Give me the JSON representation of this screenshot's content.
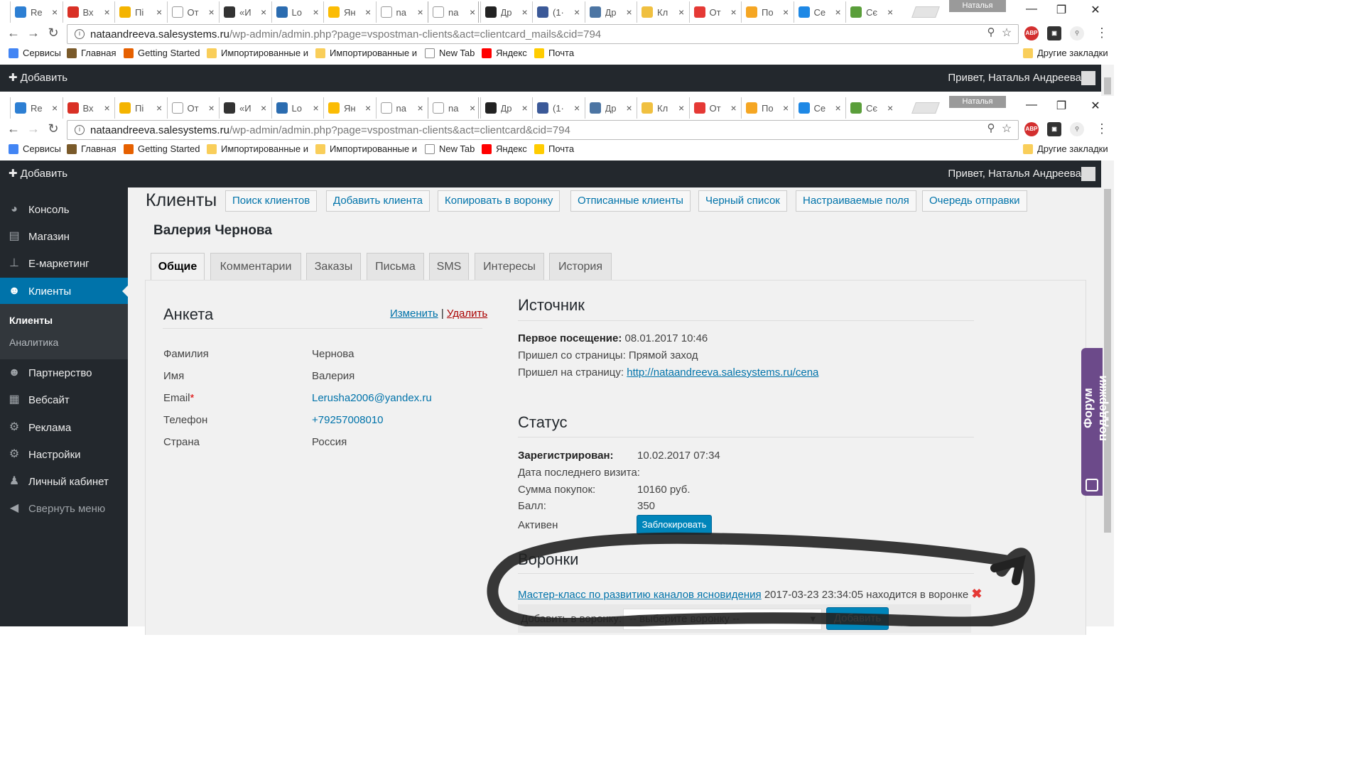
{
  "colors": {
    "accent": "#0073aa",
    "wp_bar": "#23282d",
    "support": "#6c4a8a"
  },
  "tabs": [
    {
      "label": "Re",
      "icon": "circle-at-icon",
      "color": "#2d7fd3"
    },
    {
      "label": "Вх",
      "icon": "gmail-icon",
      "color": "#d93025"
    },
    {
      "label": "Пі",
      "icon": "mail-icon",
      "color": "#f4b400"
    },
    {
      "label": "От",
      "icon": "page-icon",
      "color": "#ffffff"
    },
    {
      "label": "«И",
      "icon": "tv-icon",
      "color": "#333333"
    },
    {
      "label": "Lo",
      "icon": "p-icon",
      "color": "#2b6cb0"
    },
    {
      "label": "Ян",
      "icon": "drive-icon",
      "color": "#fbbc04"
    },
    {
      "label": "na",
      "icon": "page-icon",
      "color": "#ffffff"
    },
    {
      "label": "na",
      "icon": "page-icon",
      "color": "#ffffff"
    },
    {
      "label": "Др",
      "icon": "pro-icon",
      "color": "#222222"
    },
    {
      "label": "(1·",
      "icon": "facebook-icon",
      "color": "#3b5998"
    },
    {
      "label": "Др",
      "icon": "vk-icon",
      "color": "#4c75a3"
    },
    {
      "label": "Кл",
      "icon": "circle-icon",
      "color": "#f0c040"
    },
    {
      "label": "От",
      "icon": "arrow-icon",
      "color": "#e53935"
    },
    {
      "label": "По",
      "icon": "k-icon",
      "color": "#f5a623"
    },
    {
      "label": "Се",
      "icon": "hd-icon",
      "color": "#1e88e5"
    },
    {
      "label": "Сє",
      "icon": "puzzle-icon",
      "color": "#5a9e3a"
    }
  ],
  "profile_name": "Наталья",
  "window1": {
    "host": "nataandreeva.salesystems.ru",
    "path": "/wp-admin/admin.php?page=vspostman-clients&act=clientcard_mails&cid=794"
  },
  "window2": {
    "host": "nataandreeva.salesystems.ru",
    "path": "/wp-admin/admin.php?page=vspostman-clients&act=clientcard&cid=794"
  },
  "bookmarks": [
    {
      "label": "Сервисы",
      "color": "#4285f4"
    },
    {
      "label": "Главная",
      "color": "#7a5a2a"
    },
    {
      "label": "Getting Started",
      "color": "#e66000"
    },
    {
      "label": "Импортированные и",
      "color": "#f9ce5a"
    },
    {
      "label": "Импортированные и",
      "color": "#f9ce5a"
    },
    {
      "label": "New Tab",
      "color": "#ffffff"
    },
    {
      "label": "Яндекс",
      "color": "#ff0000"
    },
    {
      "label": "Почта",
      "color": "#ffcc00"
    }
  ],
  "other_bookmarks": "Другие закладки",
  "adminbar": {
    "add": "Добавить",
    "greeting": "Привет, Наталья Андреева"
  },
  "sidebar": {
    "items": [
      {
        "label": "Консоль",
        "icon": "dashboard-icon"
      },
      {
        "label": "Магазин",
        "icon": "store-icon"
      },
      {
        "label": "E-маркетинг",
        "icon": "sitemap-icon"
      },
      {
        "label": "Клиенты",
        "icon": "users-icon"
      },
      {
        "label": "Партнерство",
        "icon": "partners-icon"
      },
      {
        "label": "Вебсайт",
        "icon": "website-icon"
      },
      {
        "label": "Реклама",
        "icon": "gear-icon"
      },
      {
        "label": "Настройки",
        "icon": "settings-icon"
      },
      {
        "label": "Личный кабинет",
        "icon": "person-icon"
      },
      {
        "label": "Свернуть меню",
        "icon": "collapse-icon"
      }
    ],
    "sub": [
      "Клиенты",
      "Аналитика"
    ]
  },
  "page": {
    "title": "Клиенты",
    "buttons": [
      "Поиск клиентов",
      "Добавить клиента",
      "Копировать в воронку",
      "Отписанные клиенты",
      "Черный список",
      "Настраиваемые поля",
      "Очередь отправки"
    ],
    "client_name": "Валерия Чернова",
    "tabs": [
      "Общие",
      "Комментарии",
      "Заказы",
      "Письма",
      "SMS",
      "Интересы",
      "История"
    ]
  },
  "anketa": {
    "title": "Анкета",
    "edit": "Изменить",
    "sep": "|",
    "delete": "Удалить",
    "fields": [
      {
        "label": "Фамилия",
        "value": "Чернова"
      },
      {
        "label": "Имя",
        "value": "Валерия"
      },
      {
        "label": "Email",
        "value": "Lerusha2006@yandex.ru",
        "required": "*"
      },
      {
        "label": "Телефон",
        "value": "+79257008010"
      },
      {
        "label": "Страна",
        "value": "Россия"
      }
    ]
  },
  "source": {
    "title": "Источник",
    "first_visit_label": "Первое посещение:",
    "first_visit": "08.01.2017 10:46",
    "from_label": "Пришел со страницы:",
    "from": "Прямой заход",
    "to_label": "Пришел на страницу:",
    "to": "http://nataandreeva.salesystems.ru/cena"
  },
  "status": {
    "title": "Статус",
    "registered_label": "Зарегистрирован:",
    "registered": "10.02.2017 07:34",
    "last_visit_label": "Дата последнего визита:",
    "sum_label": "Сумма покупок:",
    "sum": "10160 руб.",
    "score_label": "Балл:",
    "score": "350",
    "active_label": "Активен",
    "block_btn": "Заблокировать"
  },
  "funnels": {
    "title": "Воронки",
    "link": "Мастер-класс по развитию каналов ясновидения",
    "rest": "2017-03-23 23:34:05 находится в воронке",
    "add_label": "Добавить в воронку:",
    "select_placeholder": "-- выберите воронку --",
    "add_btn": "Добавить"
  },
  "support": "Форум поддержки"
}
